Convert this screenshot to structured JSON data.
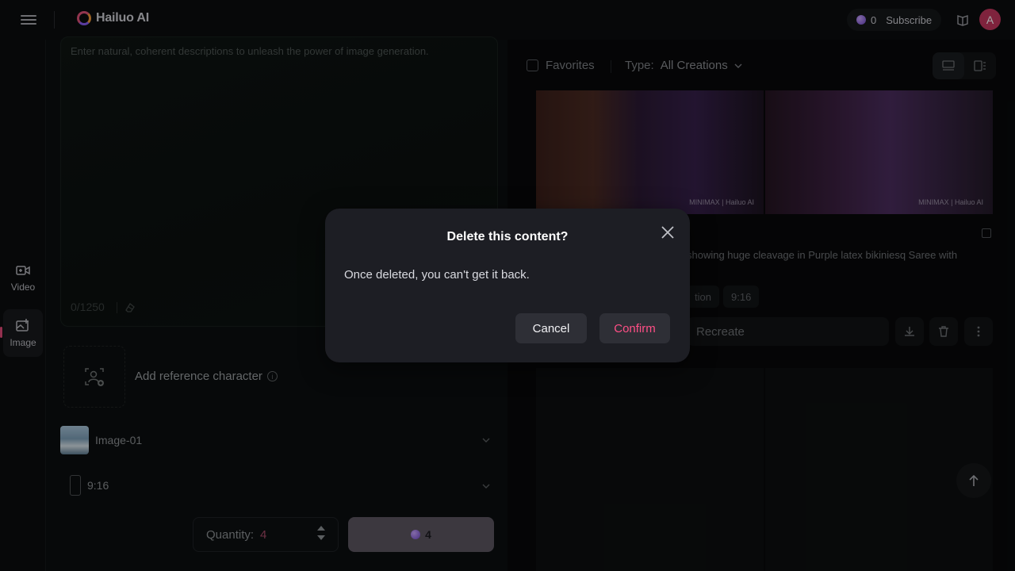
{
  "header": {
    "brand": "Hailuo AI",
    "credits": "0",
    "subscribe_label": "Subscribe",
    "avatar_initial": "A"
  },
  "rail": {
    "items": [
      {
        "label": "Video",
        "icon": "video-plus-icon"
      },
      {
        "label": "Image",
        "icon": "image-plus-icon",
        "active": true
      }
    ]
  },
  "editor": {
    "placeholder": "Enter natural, coherent descriptions to unleash the power of image generation.",
    "char_count": "0/1250",
    "reference_label": "Add reference character",
    "model_name": "Image-01",
    "aspect_ratio": "9:16",
    "quantity_label": "Quantity:",
    "quantity_value": "4",
    "generate_cost": "4"
  },
  "results": {
    "favorites_label": "Favorites",
    "type_label": "Type:",
    "type_value": "All Creations",
    "watermark": "MINIMAX | Hailuo AI",
    "description": "showing huge cleavage in Purple latex bikiniesq Saree with",
    "tags": [
      "tion",
      "9:16"
    ],
    "recreate_label": "Recreate"
  },
  "modal": {
    "title": "Delete this content?",
    "body": "Once deleted, you can't get it back.",
    "cancel_label": "Cancel",
    "confirm_label": "Confirm"
  },
  "colors": {
    "accent": "#ff4f86",
    "modal_bg": "#1d1e24",
    "avatar": "#c4365f"
  }
}
